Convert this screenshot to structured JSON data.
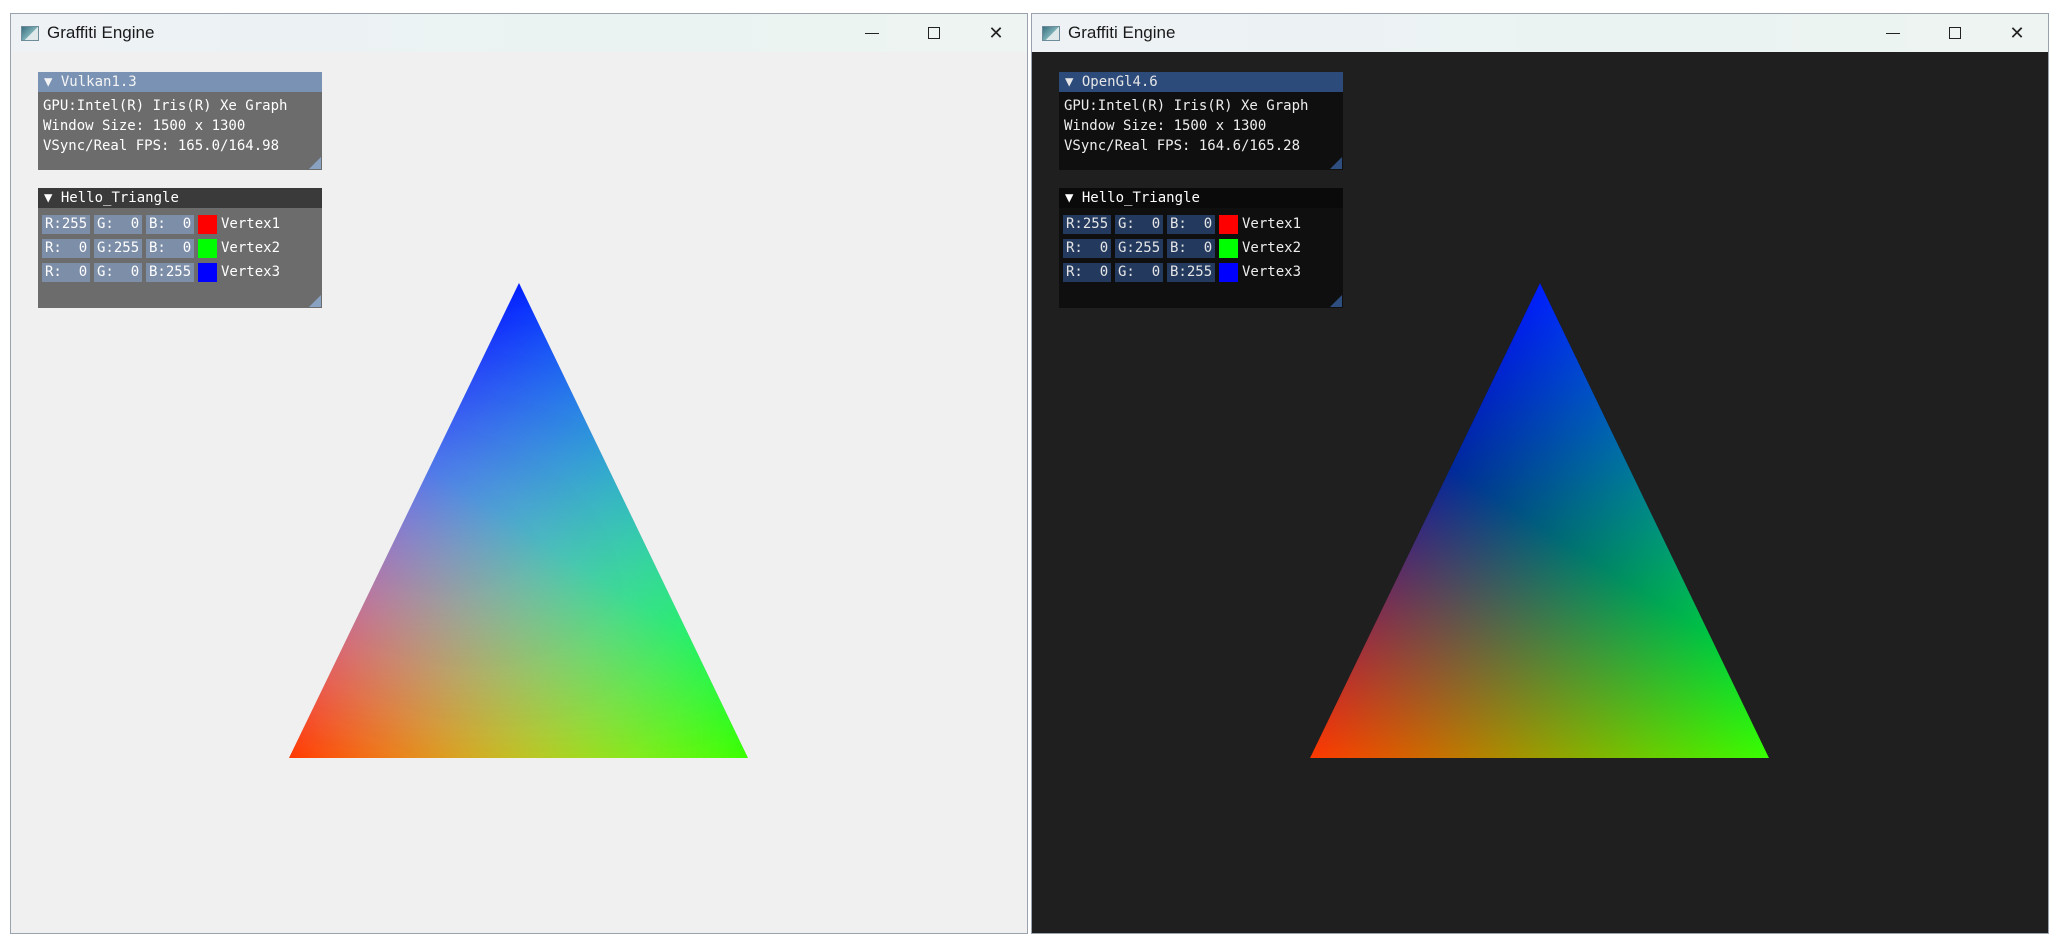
{
  "windows": [
    {
      "title": "Graffiti Engine",
      "theme": "light",
      "background": "#f0f0f0",
      "info_panel": {
        "header": "Vulkan1.3",
        "gpu": "GPU:Intel(R) Iris(R) Xe Graph",
        "window_size": "Window Size: 1500 x 1300",
        "fps": "VSync/Real FPS: 165.0/164.98"
      },
      "triangle_panel": {
        "header": "Hello_Triangle",
        "vertices": [
          {
            "r": "R:255",
            "g": "G:  0",
            "b": "B:  0",
            "color": "#ff0000",
            "label": "Vertex1"
          },
          {
            "r": "R:  0",
            "g": "G:255",
            "b": "B:  0",
            "color": "#00ff00",
            "label": "Vertex2"
          },
          {
            "r": "R:  0",
            "g": "G:  0",
            "b": "B:255",
            "color": "#0000ff",
            "label": "Vertex3"
          }
        ]
      }
    },
    {
      "title": "Graffiti Engine",
      "theme": "dark",
      "background": "#1f1f1f",
      "info_panel": {
        "header": "OpenGl4.6",
        "gpu": "GPU:Intel(R) Iris(R) Xe Graph",
        "window_size": "Window Size: 1500 x 1300",
        "fps": "VSync/Real FPS: 164.6/165.28"
      },
      "triangle_panel": {
        "header": "Hello_Triangle",
        "vertices": [
          {
            "r": "R:255",
            "g": "G:  0",
            "b": "B:  0",
            "color": "#ff0000",
            "label": "Vertex1"
          },
          {
            "r": "R:  0",
            "g": "G:255",
            "b": "B:  0",
            "color": "#00ff00",
            "label": "Vertex2"
          },
          {
            "r": "R:  0",
            "g": "G:  0",
            "b": "B:255",
            "color": "#0000ff",
            "label": "Vertex3"
          }
        ]
      }
    }
  ],
  "icons": {
    "collapse": "▼",
    "close": "✕"
  }
}
